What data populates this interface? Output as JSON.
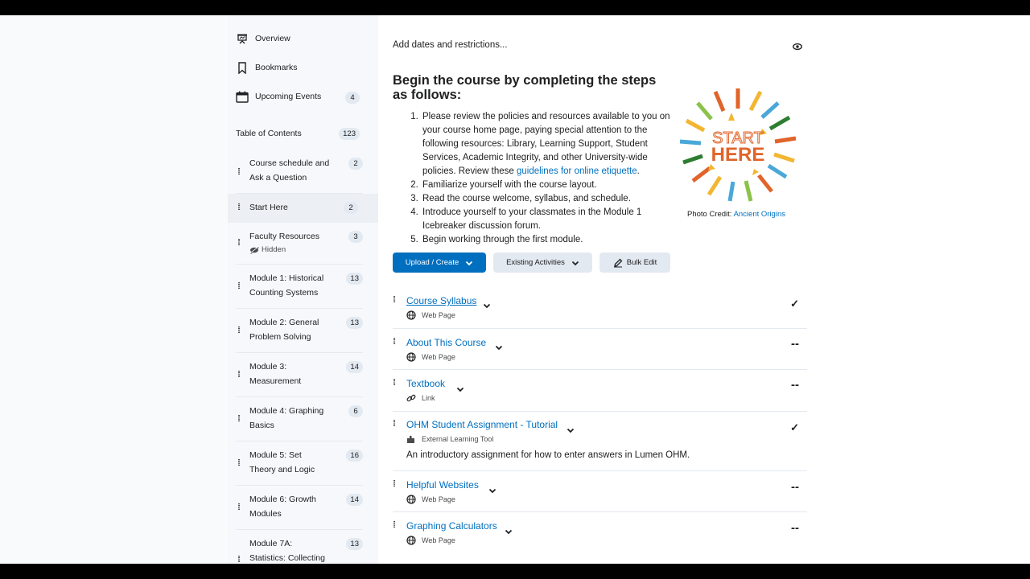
{
  "sidebar": {
    "nav": [
      {
        "label": "Overview",
        "icon": "presentation-icon"
      },
      {
        "label": "Bookmarks",
        "icon": "bookmark-icon"
      },
      {
        "label": "Upcoming Events",
        "icon": "calendar-icon",
        "count": "4"
      }
    ],
    "toc": {
      "label": "Table of Contents",
      "count": "123"
    },
    "items": [
      {
        "label": "Course schedule and Ask a Question",
        "count": "2"
      },
      {
        "label": "Start Here",
        "count": "2",
        "active": true
      },
      {
        "label": "Faculty Resources",
        "count": "3",
        "note": "Hidden"
      },
      {
        "label": "Module 1: Historical Counting Systems",
        "count": "13"
      },
      {
        "label": "Module 2: General Problem Solving",
        "count": "13"
      },
      {
        "label": "Module 3: Measurement",
        "count": "14"
      },
      {
        "label": "Module 4: Graphing Basics",
        "count": "6"
      },
      {
        "label": "Module 5: Set Theory and Logic",
        "count": "16"
      },
      {
        "label": "Module 6: Growth Modules",
        "count": "14"
      },
      {
        "label": "Module 7A: Statistics: Collecting",
        "count": "13"
      }
    ]
  },
  "main": {
    "dates_link": "Add dates and restrictions...",
    "intro_title": "Begin the course by completing the steps as follows:",
    "steps": {
      "s1a": "Please review the policies and resources available to you on your course home page, paying special attention to the following resources: Library, Learning Support, Student Services, Academic Integrity, and other University-wide policies. Review these ",
      "s1link": "guidelines for online etiquette",
      "s1end": ".",
      "s2": "Familiarize yourself with the course layout.",
      "s3": "Read the course welcome, syllabus, and schedule.",
      "s4": "Introduce yourself to your classmates in the Module 1 Icebreaker discussion forum.",
      "s5": "Begin working through the first module."
    },
    "image": {
      "line1": "START",
      "line2": "HERE"
    },
    "credit_label": "Photo Credit: ",
    "credit_link": "Ancient Origins",
    "buttons": {
      "upload": "Upload / Create",
      "existing": "Existing Activities",
      "bulk": "Bulk Edit"
    },
    "content": [
      {
        "title": "Course Syllabus",
        "type": "Web Page",
        "icon": "globe-icon",
        "status": "✓"
      },
      {
        "title": "About This Course",
        "type": "Web Page",
        "icon": "globe-icon",
        "status": "--"
      },
      {
        "title": "Textbook",
        "type": "Link",
        "icon": "link-icon",
        "status": "--"
      },
      {
        "title": "OHM Student Assignment - Tutorial",
        "type": "External Learning Tool",
        "icon": "puzzle-icon",
        "status": "✓",
        "description": "An introductory assignment for how to enter answers in Lumen OHM."
      },
      {
        "title": "Helpful Websites",
        "type": "Web Page",
        "icon": "globe-icon",
        "status": "--"
      },
      {
        "title": "Graphing Calculators",
        "type": "Web Page",
        "icon": "globe-icon",
        "status": "--"
      }
    ]
  },
  "colors": {
    "link": "#006fbf",
    "primary": "#006fbf",
    "badge": "#e3e9f1"
  }
}
